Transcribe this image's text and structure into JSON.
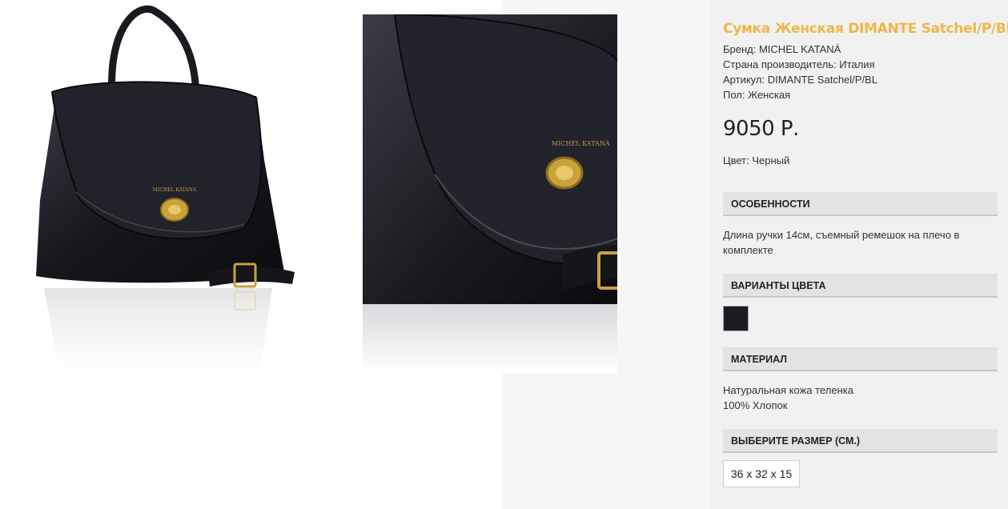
{
  "product": {
    "title": "Сумка Женская DIMANTE Satchel/P/BL",
    "brand_line": "Бренд: MICHEL KATANÁ",
    "country_line": "Страна производитель: Италия",
    "sku_line": "Артикул: DIMANTE Satchel/P/BL",
    "gender_line": "Пол: Женская",
    "price": "9050 Р.",
    "color_line": "Цвет: Черный",
    "logo_text": "MICHEL KATANÁ"
  },
  "sections": {
    "features": {
      "heading": "ОСОБЕННОСТИ",
      "text": "Длина ручки 14см, съемный ремешок на плечо в комплекте"
    },
    "color_variants": {
      "heading": "ВАРИАНТЫ ЦВЕТА",
      "swatch_color": "#1b1b24"
    },
    "material": {
      "heading": "МАТЕРИАЛ",
      "line1": "Натуральная кожа теленка",
      "line2": "100% Хлопок"
    },
    "size": {
      "heading": "ВЫБЕРИТЕ РАЗМЕР (СМ.)",
      "option": "36 x 32 x 15"
    }
  },
  "colors": {
    "accent": "#f0b64b",
    "panel_bg": "#f1f1f1",
    "section_bg": "#e3e3e3"
  }
}
